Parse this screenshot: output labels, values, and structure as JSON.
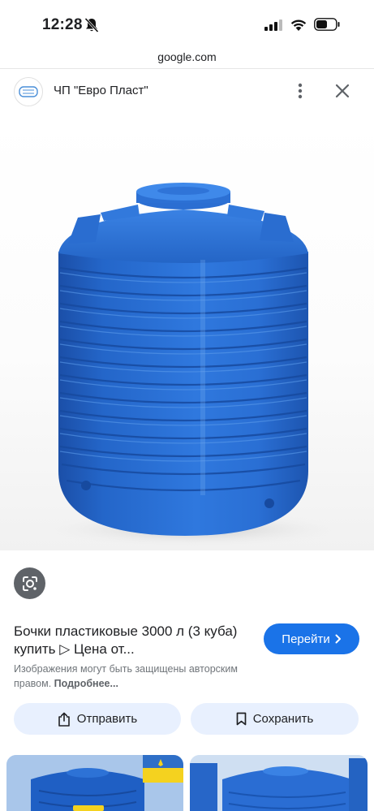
{
  "status_bar": {
    "time": "12:28",
    "icons": [
      "bell-slash-icon",
      "cellular-signal-icon",
      "wifi-icon",
      "battery-icon"
    ]
  },
  "browser": {
    "domain": "google.com"
  },
  "source": {
    "name": "ЧП \"Евро Пласт\""
  },
  "result": {
    "title": "Бочки пластиковые 3000 л (3 куба) купить ▷ Цена от...",
    "go_label": "Перейти",
    "copyright_text": "Изображения могут быть защищены авторским правом. ",
    "copyright_more": "Подробнее..."
  },
  "actions": {
    "share_label": "Отправить",
    "save_label": "Сохранить"
  },
  "colors": {
    "accent": "#1a73e8",
    "tank_blue": "#1f63c9",
    "button_bg": "#e8f0fe"
  }
}
